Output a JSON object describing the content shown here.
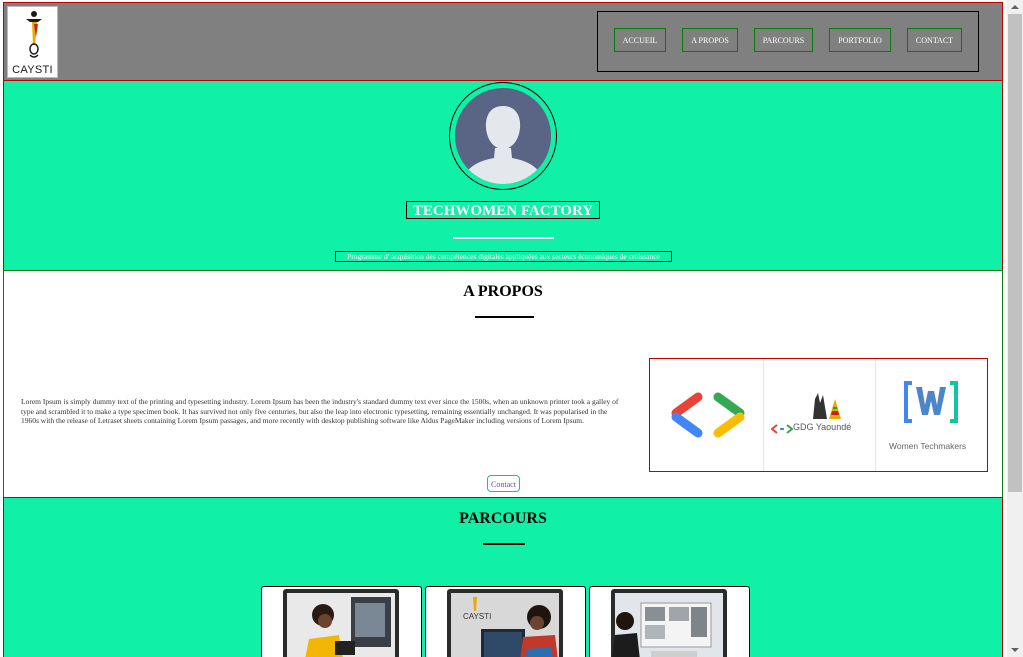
{
  "brand": {
    "logo_text": "CAYSTI"
  },
  "nav": {
    "items": [
      {
        "label": "ACCUEIL"
      },
      {
        "label": "A PROPOS"
      },
      {
        "label": "PARCOURS"
      },
      {
        "label": "PORTFOLIO"
      },
      {
        "label": "CONTACT"
      }
    ]
  },
  "hero": {
    "title": "TECHWOMEN FACTORY",
    "subtitle": "Programme d' acquisition des compétences digitales appliquées aux secteurs économiques de croissance"
  },
  "about": {
    "title": "A PROPOS",
    "body": "Lorem Ipsum is simply dummy text of the printing and typesetting industry. Lorem Ipsum has been the industry's standard dummy text ever since the 1500s, when an unknown printer took a galley of type and scrambled it to make a type specimen book. It has survived not only five centuries, but also the leap into electronic typesetting, remaining essentially unchanged. It was popularised in the 1960s with the release of Letraset sheets containing Lorem Ipsum passages, and more recently with desktop publishing software like Aldus PageMaker including versions of Lorem Ipsum.",
    "contact_label": "Contact",
    "partners": [
      {
        "name": "",
        "icon": "google-developers-logo"
      },
      {
        "name": "GDG Yaoundé",
        "icon": "gdg-yaounde-logo"
      },
      {
        "name": "Women Techmakers",
        "icon": "women-techmakers-logo"
      }
    ]
  },
  "parcours": {
    "title": "PARCOURS"
  },
  "colors": {
    "header_bg": "#808080",
    "accent_green": "#10f0a6",
    "border_red": "#c00000",
    "border_green": "#0a7a10"
  }
}
